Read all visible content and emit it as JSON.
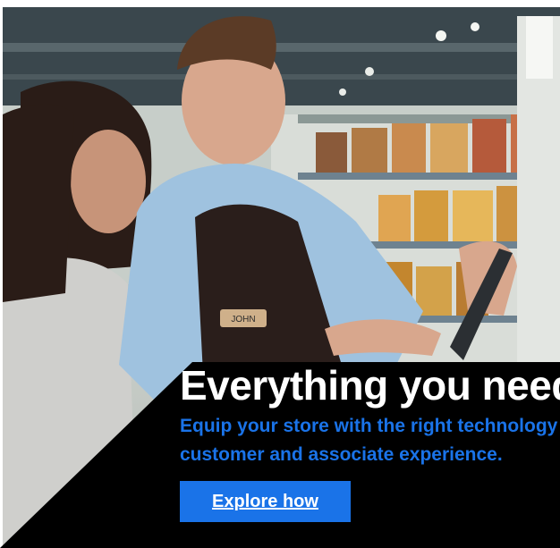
{
  "hero": {
    "name_badge": "JOHN",
    "headline": "Everything you need",
    "subtext_line1": "Equip your store with the right technology for a better",
    "subtext_line2": "customer and associate experience.",
    "cta_label": "Explore how"
  },
  "colors": {
    "accent": "#1a73e8",
    "background": "#000000",
    "headline": "#ffffff"
  }
}
